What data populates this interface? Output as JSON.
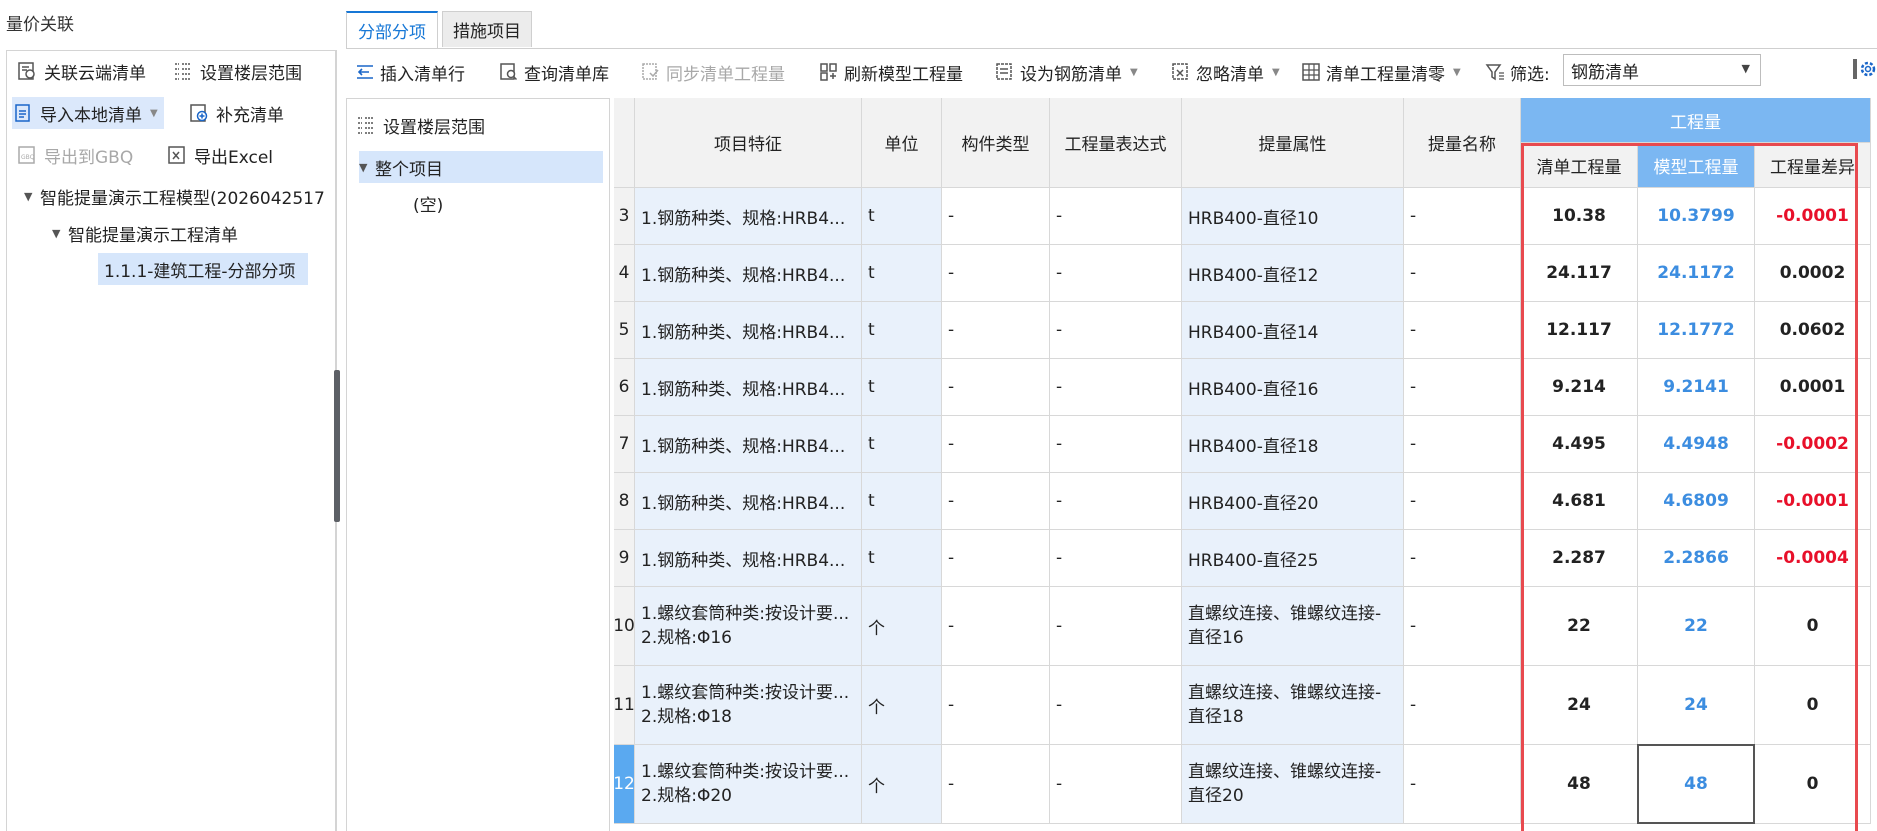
{
  "left": {
    "title": "量价关联",
    "btn_cloud": "关联云端清单",
    "btn_floor": "设置楼层范围",
    "btn_import": "导入本地清单",
    "btn_supplement": "补充清单",
    "btn_gbq": "导出到GBQ",
    "btn_excel": "导出Excel",
    "tree": [
      {
        "label": "智能提量演示工程模型(2026042517"
      },
      {
        "label": "智能提量演示工程清单"
      },
      {
        "label": "1.1.1-建筑工程-分部分项"
      }
    ]
  },
  "tabs": [
    "分部分项",
    "措施项目"
  ],
  "toolbar": {
    "insert_row": "插入清单行",
    "query_lib": "查询清单库",
    "sync_qty": "同步清单工程量",
    "refresh_model": "刷新模型工程量",
    "set_rebar": "设为钢筋清单",
    "ignore": "忽略清单",
    "zero_qty": "清单工程量清零",
    "filter_label": "筛选:",
    "filter_value": "钢筋清单"
  },
  "mid": {
    "set_floor": "设置楼层范围",
    "whole_project": "整个项目",
    "empty": "(空)"
  },
  "grid": {
    "headers": {
      "feature": "项目特征",
      "unit": "单位",
      "comp_type": "构件类型",
      "expr": "工程量表达式",
      "attr": "提量属性",
      "name": "提量名称",
      "qty_group": "工程量",
      "list_qty": "清单工程量",
      "model_qty": "模型工程量",
      "diff": "工程量差异"
    },
    "rows": [
      {
        "no": "3",
        "feature": "1.钢筋种类、规格:HRB4...",
        "feature2": "",
        "unit": "t",
        "comp": "-",
        "expr": "-",
        "attr": "HRB400-直径10",
        "attr2": "",
        "name": "-",
        "list_qty": "10.38",
        "model_qty": "10.3799",
        "diff": "-0.0001",
        "neg": true
      },
      {
        "no": "4",
        "feature": "1.钢筋种类、规格:HRB4...",
        "feature2": "",
        "unit": "t",
        "comp": "-",
        "expr": "-",
        "attr": "HRB400-直径12",
        "attr2": "",
        "name": "-",
        "list_qty": "24.117",
        "model_qty": "24.1172",
        "diff": "0.0002",
        "neg": false
      },
      {
        "no": "5",
        "feature": "1.钢筋种类、规格:HRB4...",
        "feature2": "",
        "unit": "t",
        "comp": "-",
        "expr": "-",
        "attr": "HRB400-直径14",
        "attr2": "",
        "name": "-",
        "list_qty": "12.117",
        "model_qty": "12.1772",
        "diff": "0.0602",
        "neg": false
      },
      {
        "no": "6",
        "feature": "1.钢筋种类、规格:HRB4...",
        "feature2": "",
        "unit": "t",
        "comp": "-",
        "expr": "-",
        "attr": "HRB400-直径16",
        "attr2": "",
        "name": "-",
        "list_qty": "9.214",
        "model_qty": "9.2141",
        "diff": "0.0001",
        "neg": false
      },
      {
        "no": "7",
        "feature": "1.钢筋种类、规格:HRB4...",
        "feature2": "",
        "unit": "t",
        "comp": "-",
        "expr": "-",
        "attr": "HRB400-直径18",
        "attr2": "",
        "name": "-",
        "list_qty": "4.495",
        "model_qty": "4.4948",
        "diff": "-0.0002",
        "neg": true
      },
      {
        "no": "8",
        "feature": "1.钢筋种类、规格:HRB4...",
        "feature2": "",
        "unit": "t",
        "comp": "-",
        "expr": "-",
        "attr": "HRB400-直径20",
        "attr2": "",
        "name": "-",
        "list_qty": "4.681",
        "model_qty": "4.6809",
        "diff": "-0.0001",
        "neg": true
      },
      {
        "no": "9",
        "feature": "1.钢筋种类、规格:HRB4...",
        "feature2": "",
        "unit": "t",
        "comp": "-",
        "expr": "-",
        "attr": "HRB400-直径25",
        "attr2": "",
        "name": "-",
        "list_qty": "2.287",
        "model_qty": "2.2866",
        "diff": "-0.0004",
        "neg": true
      },
      {
        "no": "10",
        "feature": "1.螺纹套筒种类:按设计要...",
        "feature2": "2.规格:Φ16",
        "unit": "个",
        "comp": "-",
        "expr": "-",
        "attr": "直螺纹连接、锥螺纹连接-",
        "attr2": "直径16",
        "name": "-",
        "list_qty": "22",
        "model_qty": "22",
        "diff": "0",
        "neg": false
      },
      {
        "no": "11",
        "feature": "1.螺纹套筒种类:按设计要...",
        "feature2": "2.规格:Φ18",
        "unit": "个",
        "comp": "-",
        "expr": "-",
        "attr": "直螺纹连接、锥螺纹连接-",
        "attr2": "直径18",
        "name": "-",
        "list_qty": "24",
        "model_qty": "24",
        "diff": "0",
        "neg": false
      },
      {
        "no": "12",
        "feature": "1.螺纹套筒种类:按设计要...",
        "feature2": "2.规格:Φ20",
        "unit": "个",
        "comp": "-",
        "expr": "-",
        "attr": "直螺纹连接、锥螺纹连接-",
        "attr2": "直径20",
        "name": "-",
        "list_qty": "48",
        "model_qty": "48",
        "diff": "0",
        "neg": false
      }
    ]
  }
}
